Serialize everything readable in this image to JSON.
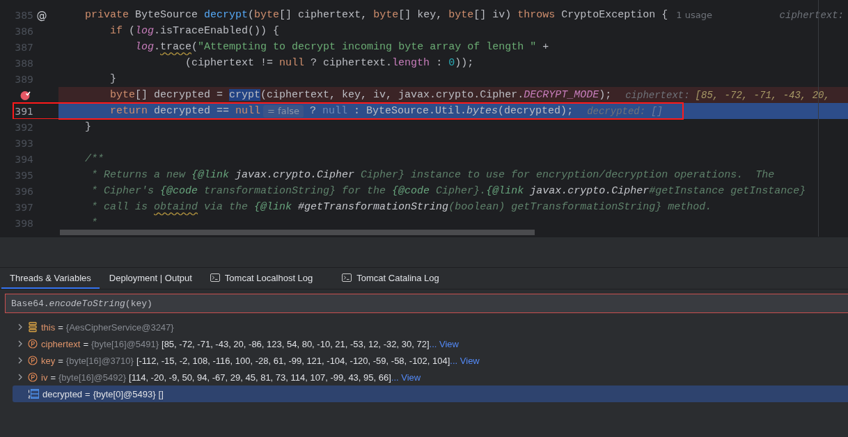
{
  "editor": {
    "lines": [
      {
        "number": "385",
        "gutter_mark": "@",
        "breakpoint": false,
        "current": false,
        "boxed": false,
        "segments": [
          {
            "kind": "code",
            "tokens": [
              {
                "text": "    private ",
                "kind": "kw"
              },
              {
                "text": "ByteSource ",
                "kind": "plain"
              },
              {
                "text": "decrypt",
                "kind": "fn"
              },
              {
                "text": "(",
                "kind": "plain"
              },
              {
                "text": "byte",
                "kind": "kw"
              },
              {
                "text": "[] ciphertext, ",
                "kind": "plain"
              },
              {
                "text": "byte",
                "kind": "kw"
              },
              {
                "text": "[] key, ",
                "kind": "plain"
              },
              {
                "text": "byte",
                "kind": "kw"
              },
              {
                "text": "[] iv) ",
                "kind": "plain"
              },
              {
                "text": "throws",
                "kind": "kw"
              },
              {
                "text": " CryptoException {",
                "kind": "plain"
              }
            ]
          },
          {
            "kind": "usage-hint",
            "text": "1 usage"
          },
          {
            "kind": "far-hint",
            "text": "ciphertext:"
          }
        ]
      },
      {
        "number": "386",
        "breakpoint": false,
        "current": false,
        "boxed": false,
        "segments": [
          {
            "kind": "code",
            "tokens": [
              {
                "text": "        if",
                "kind": "kw"
              },
              {
                "text": " (",
                "kind": "plain"
              },
              {
                "text": "log",
                "kind": "field"
              },
              {
                "text": ".isTraceEnabled()) {",
                "kind": "plain"
              }
            ]
          }
        ]
      },
      {
        "number": "387",
        "breakpoint": false,
        "current": false,
        "boxed": false,
        "segments": [
          {
            "kind": "code",
            "tokens": [
              {
                "text": "            log",
                "kind": "field"
              },
              {
                "text": ".",
                "kind": "plain"
              },
              {
                "text": "trace",
                "kind": "warn"
              },
              {
                "text": "(",
                "kind": "plain"
              },
              {
                "text": "\"Attempting to decrypt incoming byte array of length \"",
                "kind": "str"
              },
              {
                "text": " +",
                "kind": "plain"
              }
            ]
          }
        ]
      },
      {
        "number": "388",
        "breakpoint": false,
        "current": false,
        "boxed": false,
        "segments": [
          {
            "kind": "code",
            "tokens": [
              {
                "text": "                    (ciphertext != ",
                "kind": "plain"
              },
              {
                "text": "null",
                "kind": "kw"
              },
              {
                "text": " ? ciphertext.",
                "kind": "plain"
              },
              {
                "text": "length",
                "kind": "prop"
              },
              {
                "text": " : ",
                "kind": "plain"
              },
              {
                "text": "0",
                "kind": "num"
              },
              {
                "text": "));",
                "kind": "plain"
              }
            ]
          }
        ]
      },
      {
        "number": "389",
        "breakpoint": false,
        "current": false,
        "boxed": false,
        "segments": [
          {
            "kind": "code",
            "tokens": [
              {
                "text": "        }",
                "kind": "plain"
              }
            ]
          }
        ]
      },
      {
        "breakpoint": true,
        "current": false,
        "boxed": false,
        "segments": [
          {
            "kind": "code",
            "tokens": [
              {
                "text": "        byte",
                "kind": "kw"
              },
              {
                "text": "[] decrypted = ",
                "kind": "plain"
              },
              {
                "text": "crypt",
                "kind": "sel"
              },
              {
                "text": "(ciphertext, key, iv, javax.crypto.Cipher.",
                "kind": "plain"
              },
              {
                "text": "DECRYPT_MODE",
                "kind": "static"
              },
              {
                "text": ");",
                "kind": "plain"
              }
            ]
          },
          {
            "kind": "value-hint",
            "label": "ciphertext:",
            "value": "[85, -72, -71, -43, 20,"
          }
        ]
      },
      {
        "number": "391",
        "breakpoint": false,
        "current": true,
        "boxed": true,
        "segments": [
          {
            "kind": "code",
            "tokens": [
              {
                "text": "        return",
                "kind": "kw"
              },
              {
                "text": " decrypted == ",
                "kind": "plain"
              },
              {
                "text": "null",
                "kind": "kw"
              }
            ]
          },
          {
            "kind": "chip",
            "text": "= false"
          },
          {
            "kind": "code",
            "tokens": [
              {
                "text": " ? ",
                "kind": "plain"
              },
              {
                "text": "null",
                "kind": "dim"
              },
              {
                "text": " : ByteSource.Util.",
                "kind": "plain"
              },
              {
                "text": "bytes",
                "kind": "italic"
              },
              {
                "text": "(decrypted);",
                "kind": "plain"
              }
            ]
          },
          {
            "kind": "value-hint",
            "label": "decrypted:",
            "value": "[]"
          }
        ]
      },
      {
        "number": "392",
        "breakpoint": false,
        "current": false,
        "boxed": false,
        "segments": [
          {
            "kind": "code",
            "tokens": [
              {
                "text": "    }",
                "kind": "plain"
              }
            ]
          }
        ]
      },
      {
        "number": "393",
        "breakpoint": false,
        "current": false,
        "boxed": false
      },
      {
        "number": "394",
        "breakpoint": false,
        "current": false,
        "boxed": false,
        "segments": [
          {
            "kind": "code",
            "tokens": [
              {
                "text": "    /**",
                "kind": "doc"
              }
            ]
          }
        ]
      },
      {
        "number": "395",
        "breakpoint": false,
        "current": false,
        "boxed": false,
        "segments": [
          {
            "kind": "code",
            "tokens": [
              {
                "text": "     * Returns a new ",
                "kind": "doc"
              },
              {
                "text": "{@link",
                "kind": "doctag"
              },
              {
                "text": " javax.crypto.Cipher",
                "kind": "docref"
              },
              {
                "text": " Cipher} instance to use for encryption/decryption operations.  The",
                "kind": "doc"
              }
            ]
          }
        ]
      },
      {
        "number": "396",
        "breakpoint": false,
        "current": false,
        "boxed": false,
        "segments": [
          {
            "kind": "code",
            "tokens": [
              {
                "text": "     * Cipher's ",
                "kind": "doc"
              },
              {
                "text": "{@code",
                "kind": "doctag"
              },
              {
                "text": " transformationString} for the ",
                "kind": "doc"
              },
              {
                "text": "{@code",
                "kind": "doctag"
              },
              {
                "text": " Cipher}.",
                "kind": "doc"
              },
              {
                "text": "{@link",
                "kind": "doctag"
              },
              {
                "text": " javax.crypto.Cipher",
                "kind": "docref"
              },
              {
                "text": "#getInstance getInstance}",
                "kind": "doc"
              }
            ]
          }
        ]
      },
      {
        "number": "397",
        "breakpoint": false,
        "current": false,
        "boxed": false,
        "segments": [
          {
            "kind": "code",
            "tokens": [
              {
                "text": "     * call is ",
                "kind": "doc"
              },
              {
                "text": "obtaind",
                "kind": "docwarn"
              },
              {
                "text": " via the ",
                "kind": "doc"
              },
              {
                "text": "{@link",
                "kind": "doctag"
              },
              {
                "text": " #getTransformationString",
                "kind": "docref"
              },
              {
                "text": "(boolean) getTransformationString} method.",
                "kind": "doc"
              }
            ]
          }
        ]
      },
      {
        "number": "398",
        "breakpoint": false,
        "current": false,
        "boxed": false,
        "segments": [
          {
            "kind": "code",
            "tokens": [
              {
                "text": "     *",
                "kind": "doc"
              }
            ]
          }
        ]
      }
    ]
  },
  "debug_panel": {
    "tabs": [
      {
        "label": "Threads & Variables",
        "kind": "text",
        "selected": true
      },
      {
        "label": "Deployment | Output",
        "kind": "text",
        "selected": false
      },
      {
        "label": "Tomcat Localhost Log",
        "kind": "console",
        "selected": false
      },
      {
        "label": "Tomcat Catalina Log",
        "kind": "console",
        "selected": false
      }
    ],
    "expression": {
      "value": "Base64.*encodeToString*(key)"
    },
    "variables": [
      {
        "kind": "object",
        "expandable": true,
        "selected": false,
        "name": "this",
        "equals": "=",
        "type": "{AesCipherService@3247}"
      },
      {
        "kind": "param",
        "expandable": true,
        "selected": false,
        "name": "ciphertext",
        "equals": "=",
        "type": "{byte[16]@5491}",
        "value": "[85, -72, -71, -43, 20, -86, 123, 54, 80, -10, 21, -53, 12, -32, 30, 72]",
        "link": "... View"
      },
      {
        "kind": "param",
        "expandable": true,
        "selected": false,
        "name": "key",
        "equals": "=",
        "type": "{byte[16]@3710}",
        "value": "[-112, -15, -2, 108, -116, 100, -28, 61, -99, 121, -104, -120, -59, -58, -102, 104]",
        "link": "... View"
      },
      {
        "kind": "param",
        "expandable": true,
        "selected": false,
        "name": "iv",
        "equals": "=",
        "type": "{byte[16]@5492}",
        "value": "[114, -20, -9, 50, 94, -67, 29, 45, 81, 73, 114, 107, -99, 43, 95, 66]",
        "link": "... View"
      },
      {
        "kind": "array",
        "expandable": false,
        "selected": true,
        "name": "decrypted",
        "equals": "=",
        "type": "{byte[0]@5493}",
        "value": "[]"
      }
    ]
  }
}
